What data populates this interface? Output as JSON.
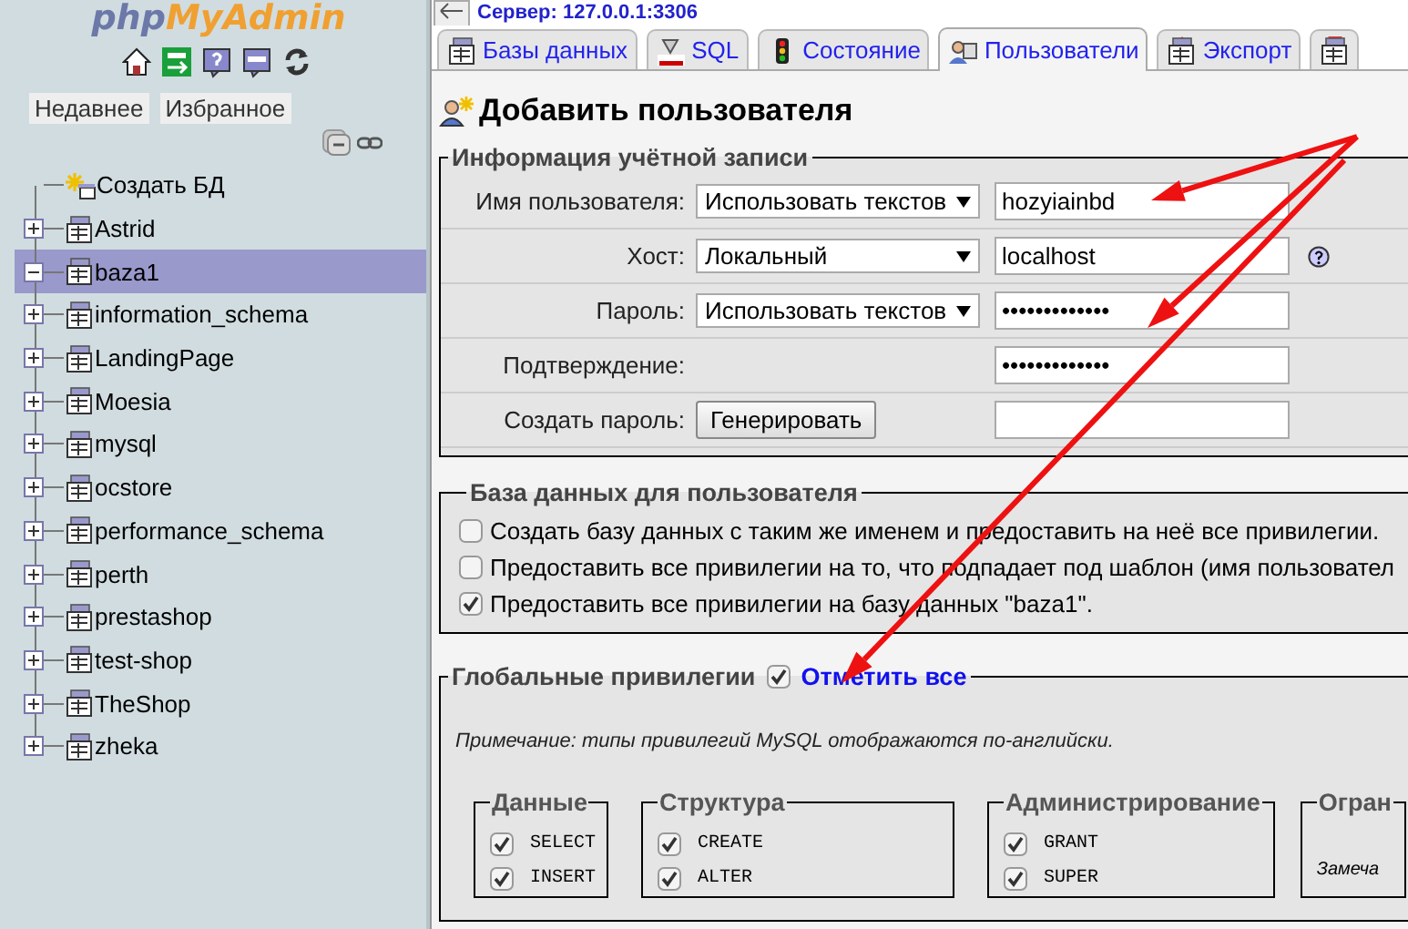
{
  "sidebar": {
    "logo": [
      "php",
      "MyAdmin"
    ],
    "nav_buttons": [
      {
        "label": "Недавнее"
      },
      {
        "label": "Избранное"
      }
    ],
    "tree": [
      {
        "kind": "new",
        "label": "Создать БД"
      },
      {
        "kind": "db",
        "label": "Astrid",
        "expanded": false,
        "selected": false
      },
      {
        "kind": "db",
        "label": "baza1",
        "expanded": true,
        "selected": true
      },
      {
        "kind": "db",
        "label": "information_schema",
        "expanded": false,
        "selected": false
      },
      {
        "kind": "db",
        "label": "LandingPage",
        "expanded": false,
        "selected": false
      },
      {
        "kind": "db",
        "label": "Moesia",
        "expanded": false,
        "selected": false
      },
      {
        "kind": "db",
        "label": "mysql",
        "expanded": false,
        "selected": false
      },
      {
        "kind": "db",
        "label": "ocstore",
        "expanded": false,
        "selected": false
      },
      {
        "kind": "db",
        "label": "performance_schema",
        "expanded": false,
        "selected": false
      },
      {
        "kind": "db",
        "label": "perth",
        "expanded": false,
        "selected": false
      },
      {
        "kind": "db",
        "label": "prestashop",
        "expanded": false,
        "selected": false
      },
      {
        "kind": "db",
        "label": "test-shop",
        "expanded": false,
        "selected": false
      },
      {
        "kind": "db",
        "label": "TheShop",
        "expanded": false,
        "selected": false
      },
      {
        "kind": "db",
        "label": "zheka",
        "expanded": false,
        "selected": false
      }
    ]
  },
  "server": "Сервер: 127.0.0.1:3306",
  "tabs": [
    {
      "label": "Базы данных",
      "selected": false
    },
    {
      "label": "SQL",
      "selected": false
    },
    {
      "label": "Состояние",
      "selected": false
    },
    {
      "label": "Пользователи",
      "selected": true
    },
    {
      "label": "Экспорт",
      "selected": false
    },
    {
      "selected": false
    }
  ],
  "page_title": "Добавить пользователя",
  "account": {
    "legend": "Информация учётной записи",
    "rows": [
      {
        "kind": "select",
        "label": "Имя пользователя:",
        "select": "Использовать текстов",
        "value": "hozyiainbd"
      },
      {
        "kind": "select",
        "label": "Хост:",
        "select": "Локальный",
        "value": "localhost",
        "help": true
      },
      {
        "kind": "select",
        "label": "Пароль:",
        "select": "Использовать текстов",
        "value": "•••••••••••••"
      },
      {
        "kind": "plain",
        "label": "Подтверждение:",
        "value": "•••••••••••••"
      },
      {
        "kind": "button",
        "label": "Создать пароль:",
        "button": "Генерировать"
      }
    ]
  },
  "database": {
    "legend": "База данных для пользователя",
    "options": [
      {
        "label": "Создать базу данных с таким же именем и предоставить на неё все привилегии.",
        "checked": false
      },
      {
        "label": "Предоставить все привилегии на то, что подпадает под шаблон (имя пользовател",
        "checked": false
      },
      {
        "label": "Предоставить все привилегии на базу данных \"baza1\".",
        "checked": true
      }
    ]
  },
  "global": {
    "legend": "Глобальные привилегии",
    "check_all": {
      "label": "Отметить все",
      "checked": true
    },
    "note": "Примечание: типы привилегий MySQL отображаются по-английски.",
    "groups": [
      {
        "legend": "Данные",
        "items": [
          {
            "label": "SELECT",
            "checked": true
          },
          {
            "label": "INSERT",
            "checked": true
          }
        ]
      },
      {
        "legend": "Структура",
        "items": [
          {
            "label": "CREATE",
            "checked": true
          },
          {
            "label": "ALTER",
            "checked": true
          }
        ]
      },
      {
        "legend": "Администрирование",
        "items": [
          {
            "label": "GRANT",
            "checked": true
          },
          {
            "label": "SUPER",
            "checked": true
          }
        ]
      },
      {
        "legend": "Огран",
        "note": "Замеча"
      }
    ]
  }
}
